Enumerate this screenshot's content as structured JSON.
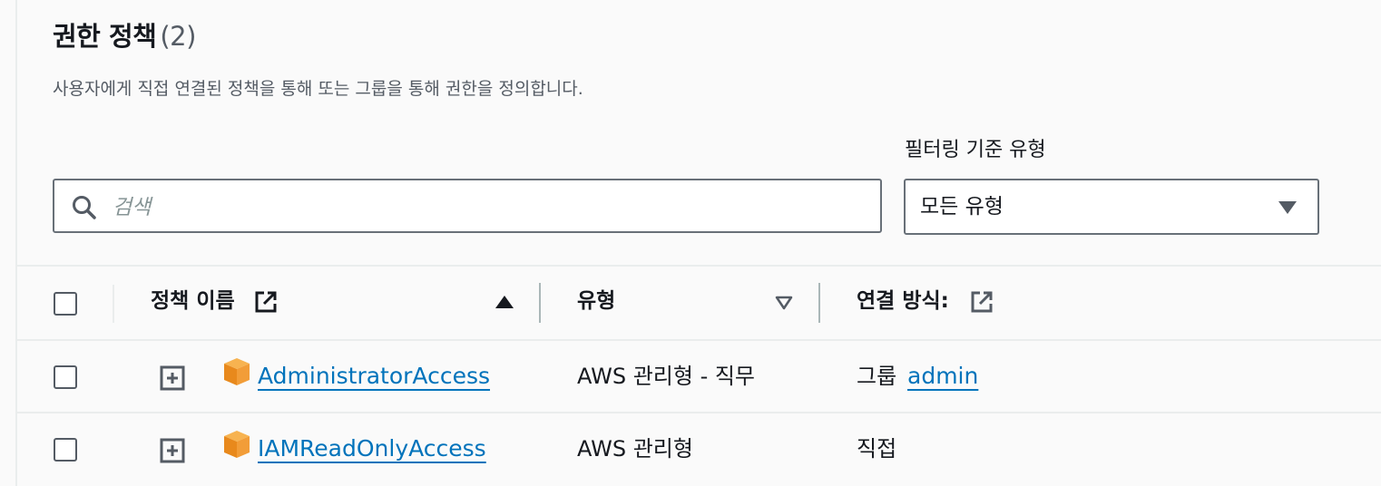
{
  "section": {
    "title": "권한 정책",
    "count": "(2)",
    "description": "사용자에게 직접 연결된 정책을 통해 또는 그룹을 통해 권한을 정의합니다."
  },
  "filters": {
    "search_placeholder": "검색",
    "search_value": "",
    "type_label": "필터링 기준 유형",
    "type_selected": "모든 유형"
  },
  "table": {
    "columns": [
      {
        "label": "정책 이름",
        "external_icon": "external-link-icon",
        "sort": "ascending"
      },
      {
        "label": "유형",
        "sort": "unsorted"
      },
      {
        "label": "연결 방식:",
        "external_icon": "external-link-icon"
      }
    ],
    "rows": [
      {
        "name": "AdministratorAccess",
        "type": "AWS 관리형 - 직무",
        "attached_prefix": "그룹",
        "attached_link": "admin"
      },
      {
        "name": "IAMReadOnlyAccess",
        "type": "AWS 관리형",
        "attached_prefix": "직접",
        "attached_link": ""
      }
    ]
  },
  "colors": {
    "link": "#0073bb",
    "policy_icon": "#f29d38",
    "border": "#687078",
    "background": "#fafafa"
  }
}
